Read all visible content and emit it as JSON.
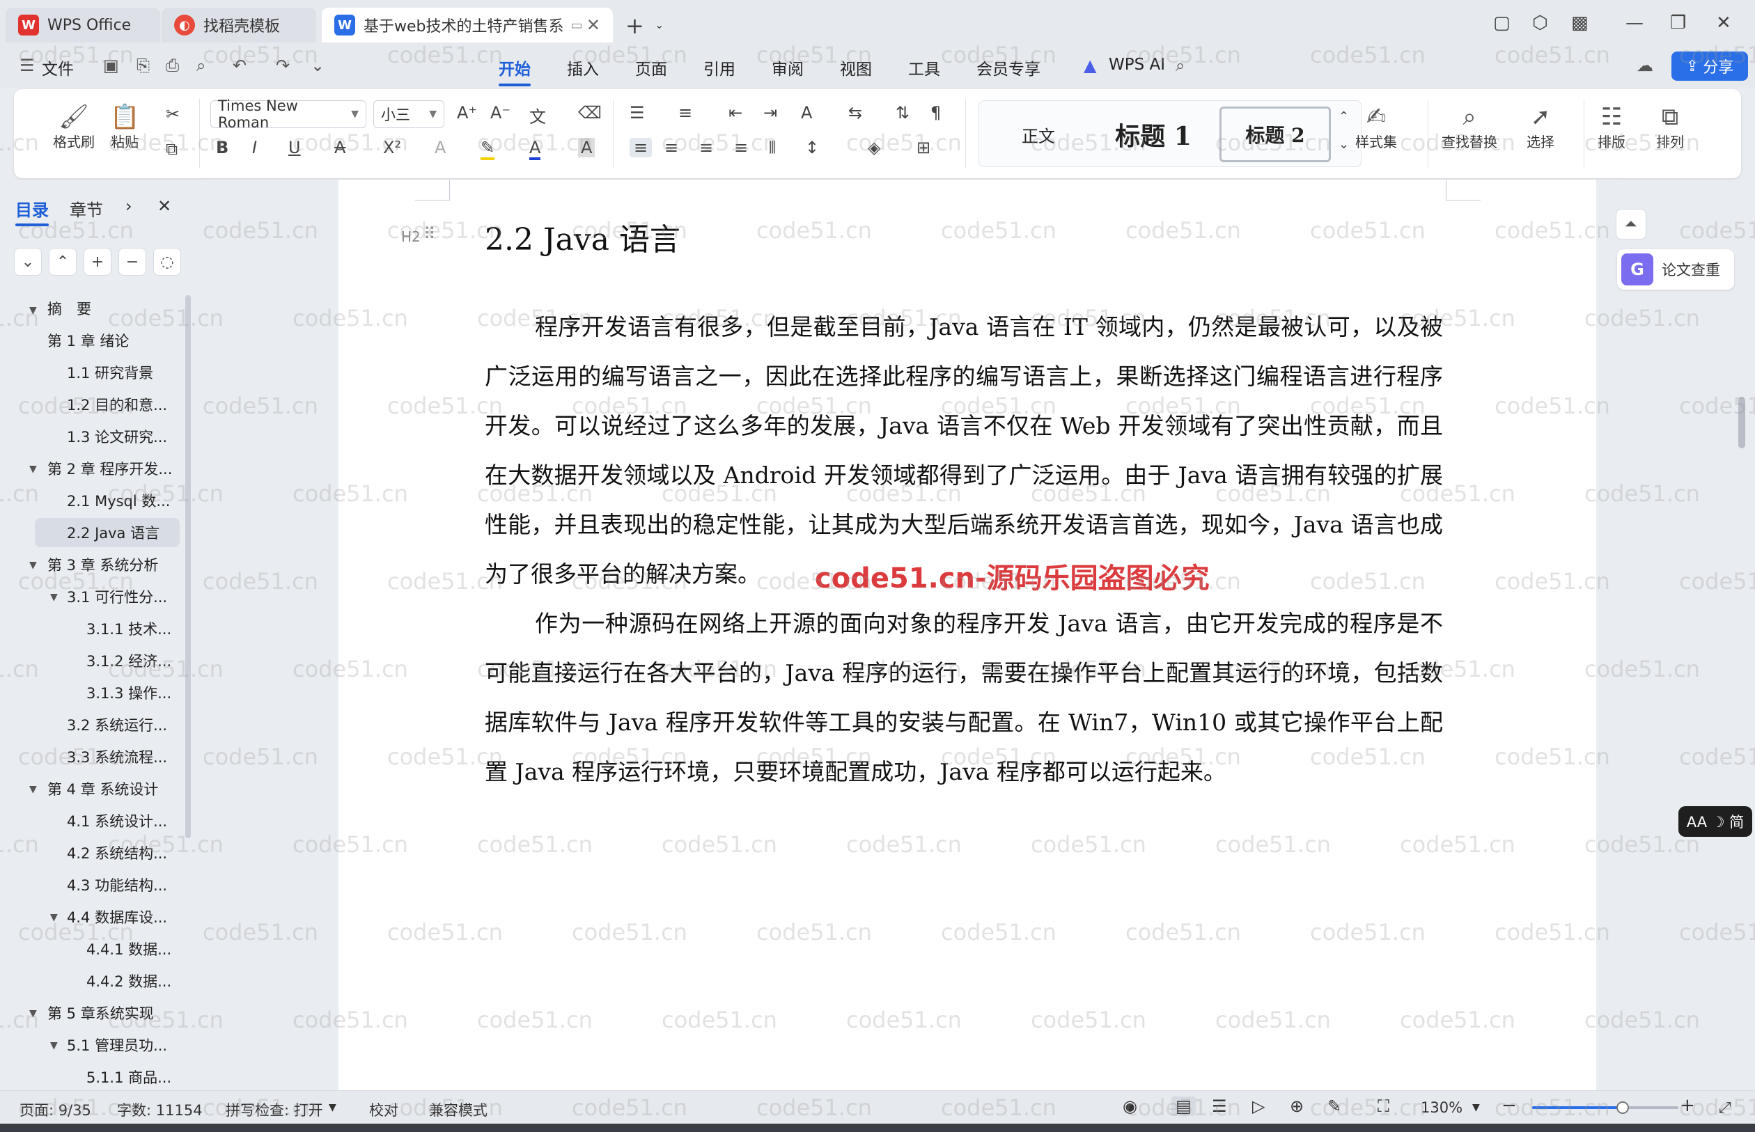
{
  "tabs": {
    "wps": "WPS Office",
    "template": "找稻壳模板",
    "doc": "基于web技术的土特产销售系"
  },
  "menu": {
    "file": "文件",
    "items": [
      "开始",
      "插入",
      "页面",
      "引用",
      "审阅",
      "视图",
      "工具",
      "会员专享"
    ],
    "wps_ai": "WPS AI",
    "share": "分享"
  },
  "ribbon": {
    "format_painter": "格式刷",
    "paste": "粘贴",
    "font_name": "Times New Roman",
    "font_size": "小三",
    "styles": {
      "normal": "正文",
      "h1": "标题  1",
      "h2": "标题  2"
    },
    "style_set": "样式集",
    "find_replace": "查找替换",
    "select": "选择",
    "layout": "排版",
    "arrange": "排列"
  },
  "nav": {
    "tab_toc": "目录",
    "tab_chapter": "章节",
    "items": [
      "摘　要",
      "第 1 章  绪论",
      "1.1  研究背景",
      "1.2 目的和意...",
      "1.3  论文研究...",
      "第 2 章  程序开发...",
      "2.1 Mysql 数...",
      "2.2 Java 语言",
      "第 3 章  系统分析",
      "3.1 可行性分...",
      "3.1.1 技术...",
      "3.1.2 经济...",
      "3.1.3 操作...",
      "3.2 系统运行...",
      "3.3 系统流程...",
      "第 4 章  系统设计",
      "4.1  系统设计...",
      "4.2  系统结构...",
      "4.3 功能结构...",
      "4.4 数据库设...",
      "4.4.1  数据...",
      "4.4.2  数据...",
      "第 5 章系统实现",
      "5.1 管理员功...",
      "5.1.1  商品..."
    ]
  },
  "doc": {
    "heading_tag": "H2",
    "heading": "2.2 Java 语言",
    "para1": "程序开发语言有很多，但是截至目前，Java 语言在 IT 领域内，仍然是最被认可，以及被广泛运用的编写语言之一，因此在选择此程序的编写语言上，果断选择这门编程语言进行程序开发。可以说经过了这么多年的发展，Java 语言不仅在 Web 开发领域有了突出性贡献，而且在大数据开发领域以及 Android 开发领域都得到了广泛运用。由于 Java 语言拥有较强的扩展性能，并且表现出的稳定性能，让其成为大型后端系统开发语言首选，现如今，Java 语言也成为了很多平台的解决方案。",
    "para2": "作为一种源码在网络上开源的面向对象的程序开发 Java 语言，由它开发完成的程序是不可能直接运行在各大平台的，Java 程序的运行，需要在操作平台上配置其运行的环境，包括数据库软件与 Java 程序开发软件等工具的安装与配置。在 Win7，Win10 或其它操作平台上配置 Java 程序运行环境，只要环境配置成功，Java 程序都可以运行起来。",
    "overlay": "code51.cn-源码乐园盗图必究"
  },
  "right": {
    "thesis_check": "论文查重",
    "font_tool": "AA ☽ 简"
  },
  "status": {
    "page": "页面: 9/35",
    "words": "字数: 11154",
    "spell": "拼写检查: 打开",
    "proof": "校对",
    "compat": "兼容模式",
    "zoom": "130%",
    "zoom_fraction": 0.62
  },
  "watermark": "code51.cn",
  "colors": {
    "accent": "#1e5fd8",
    "overlay": "#d9262a"
  }
}
